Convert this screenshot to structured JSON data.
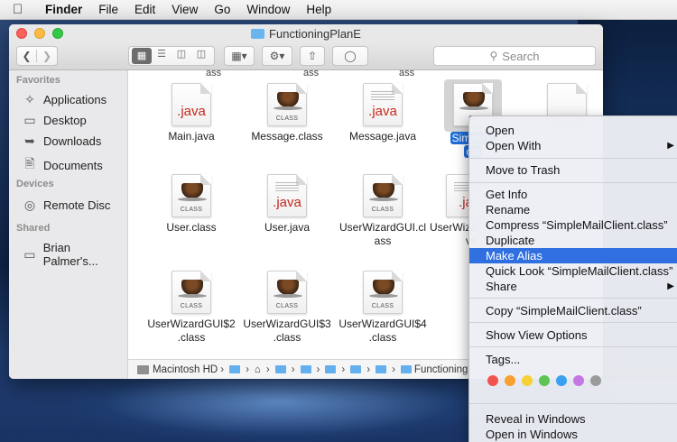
{
  "menubar": {
    "app": "Finder",
    "items": [
      "File",
      "Edit",
      "View",
      "Go",
      "Window",
      "Help"
    ]
  },
  "window": {
    "title": "FunctioningPlanE",
    "search_placeholder": "Search"
  },
  "sidebar": {
    "favorites_heading": "Favorites",
    "favorites": [
      "Applications",
      "Desktop",
      "Downloads",
      "Documents"
    ],
    "devices_heading": "Devices",
    "devices": [
      "Remote Disc"
    ],
    "shared_heading": "Shared",
    "shared": [
      "Brian Palmer's..."
    ]
  },
  "files": {
    "cut_labels": [
      "ass",
      "ass",
      "ass"
    ],
    "row1": [
      "Main.java",
      "Message.class",
      "Message.java",
      "SimpleMailClient.class"
    ],
    "row1_sel_line1": "SimpleM",
    "row1_sel_line2": "cla",
    "row2": [
      "User.class",
      "User.java",
      "UserWizardGUI.cl ass",
      "UserWiza"
    ],
    "row2_line2": "ass",
    "row2_partial2": "va",
    "row3_line1": [
      "UserWizardGUI$2",
      "UserWizardGUI$3",
      "UserWizardGUI$4"
    ],
    "row3_line2": [
      ".class",
      ".class",
      ".class"
    ],
    "java_label": ".java",
    "class_label": "CLASS",
    "class_cut": "CL",
    "java_cut": ".ja"
  },
  "pathbar": {
    "drive": "Macintosh HD",
    "last": "Functioning"
  },
  "context_menu": {
    "open": "Open",
    "open_with": "Open With",
    "move_to_trash": "Move to Trash",
    "get_info": "Get Info",
    "rename": "Rename",
    "compress": "Compress “SimpleMailClient.class”",
    "duplicate": "Duplicate",
    "make_alias": "Make Alias",
    "quick_look": "Quick Look “SimpleMailClient.class”",
    "share": "Share",
    "copy": "Copy “SimpleMailClient.class”",
    "show_view_options": "Show View Options",
    "tags": "Tags...",
    "reveal_in_windows": "Reveal in Windows",
    "open_in_windows": "Open in Windows",
    "highlighted": "Make Alias"
  },
  "tag_colors": [
    "#f2534f",
    "#f8a030",
    "#f7d035",
    "#5cc555",
    "#3aa0f0",
    "#c476e2",
    "#9a9a9a"
  ],
  "icons": [
    "apple-icon",
    "back-icon",
    "forward-icon",
    "icon-view-icon",
    "list-view-icon",
    "column-view-icon",
    "cover-flow-icon",
    "arrange-icon",
    "action-gear-icon",
    "share-icon",
    "tag-icon",
    "search-icon",
    "applications-icon",
    "desktop-icon",
    "downloads-icon",
    "documents-icon",
    "disc-icon",
    "computer-icon"
  ]
}
